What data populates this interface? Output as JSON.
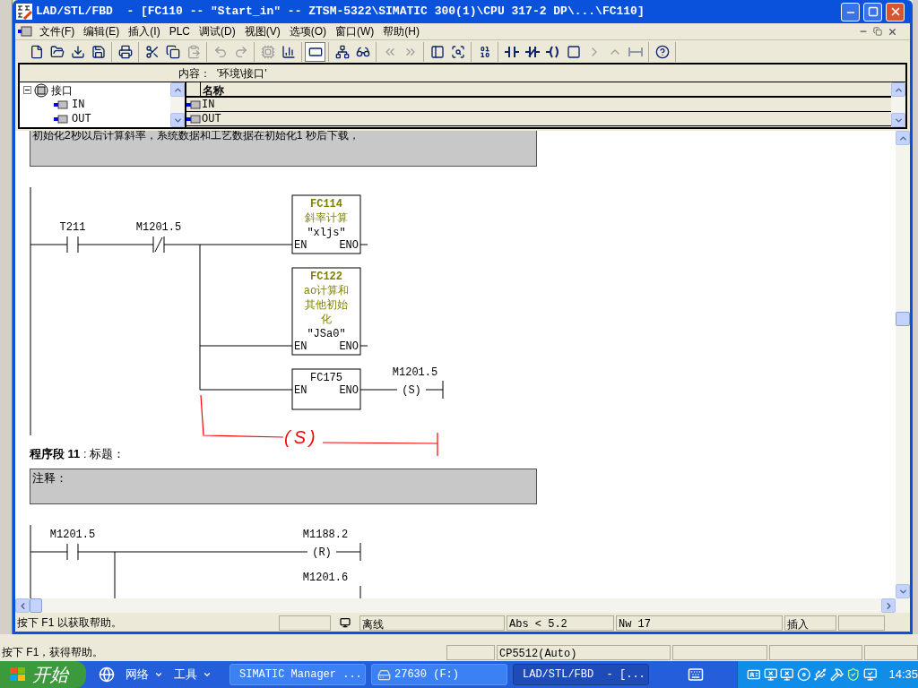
{
  "window": {
    "title": "LAD/STL/FBD  - [FC110 -- ″Start_in″ -- ZTSM-5322\\SIMATIC 300(1)\\CPU 317-2 DP\\...\\FC110]"
  },
  "menu": [
    "文件(F)",
    "编辑(E)",
    "插入(I)",
    "PLC",
    "调试(D)",
    "视图(V)",
    "选项(O)",
    "窗口(W)",
    "帮助(H)"
  ],
  "toolbar": [
    [
      {
        "kind": "new",
        "disabled": false,
        "pressed": false
      },
      {
        "kind": "open",
        "disabled": false,
        "pressed": false
      },
      {
        "kind": "download",
        "disabled": false,
        "pressed": false
      },
      {
        "kind": "save",
        "disabled": false,
        "pressed": false
      }
    ],
    [
      {
        "kind": "print",
        "disabled": false,
        "pressed": false
      }
    ],
    [
      {
        "kind": "cut",
        "disabled": false,
        "pressed": false
      },
      {
        "kind": "copy",
        "disabled": false,
        "pressed": false
      },
      {
        "kind": "paste",
        "disabled": true,
        "pressed": false
      }
    ],
    [
      {
        "kind": "undo",
        "disabled": true,
        "pressed": false
      },
      {
        "kind": "redo",
        "disabled": true,
        "pressed": false
      }
    ],
    [
      {
        "kind": "compile",
        "disabled": true,
        "pressed": false
      },
      {
        "kind": "monitor",
        "disabled": false,
        "pressed": false
      }
    ],
    [
      {
        "kind": "overview",
        "disabled": false,
        "pressed": true
      }
    ],
    [
      {
        "kind": "network",
        "disabled": false,
        "pressed": false
      },
      {
        "kind": "glasses",
        "disabled": false,
        "pressed": false
      }
    ],
    [
      {
        "kind": "prev",
        "disabled": true,
        "pressed": false
      },
      {
        "kind": "next",
        "disabled": true,
        "pressed": false
      }
    ],
    [
      {
        "kind": "details",
        "disabled": false,
        "pressed": false
      },
      {
        "kind": "zoom",
        "disabled": false,
        "pressed": false
      }
    ],
    [
      {
        "kind": "bits",
        "disabled": false,
        "pressed": false
      }
    ],
    [
      {
        "kind": "contact",
        "disabled": false,
        "pressed": false
      },
      {
        "kind": "nc-contact",
        "disabled": false,
        "pressed": false
      },
      {
        "kind": "coil",
        "disabled": false,
        "pressed": false
      },
      {
        "kind": "empty-box",
        "disabled": false,
        "pressed": false
      },
      {
        "kind": "open-branch",
        "disabled": true,
        "pressed": false
      },
      {
        "kind": "close-branch",
        "disabled": true,
        "pressed": false
      },
      {
        "kind": "jump",
        "disabled": true,
        "pressed": false
      }
    ],
    [
      {
        "kind": "help",
        "disabled": false,
        "pressed": false
      }
    ]
  ],
  "interface": {
    "path": "内容：  '环境\\接口'",
    "tree": {
      "label": "接口",
      "expanded": true,
      "children": [
        {
          "label": "IN"
        },
        {
          "label": "OUT"
        }
      ]
    },
    "column": "名称",
    "rows": [
      "IN",
      "OUT"
    ]
  },
  "networks": [
    {
      "comment": "初始化2秒以后计算斜率，系统数据和工艺数据在初始化1 秒后下载，",
      "contacts": [
        {
          "operand": "T211",
          "kind": "no"
        },
        {
          "operand": "M1201.5",
          "kind": "nc"
        }
      ],
      "blocks": [
        {
          "name": "FC114",
          "comment": [
            "斜率计算"
          ],
          "symbol": "″xljs″",
          "pins": [
            "EN",
            "ENO"
          ]
        },
        {
          "name": "FC122",
          "comment": [
            "ao计算和",
            "其他初始",
            "化"
          ],
          "symbol": "″JSa0″",
          "pins": [
            "EN",
            "ENO"
          ]
        },
        {
          "name": "FC175",
          "pins": [
            "EN",
            "ENO"
          ],
          "coil": {
            "operand": "M1201.5",
            "symbol": "(S)"
          }
        }
      ],
      "annotation": "(S)"
    },
    {
      "title": "**程序段  11** : 标题：",
      "comment": "注释：",
      "contacts": [
        {
          "operand": "M1201.5",
          "kind": "no"
        }
      ],
      "coils": [
        {
          "operand": "M1188.2",
          "symbol": "(R)"
        },
        {
          "operand": "M1201.6"
        }
      ]
    }
  ],
  "status_bar": {
    "hint": "按下 F1 以获取帮助。",
    "mode": "离线",
    "address": "Abs < 5.2",
    "network": "Nw 17",
    "input": "插入"
  },
  "manager_status": {
    "hint": "按下 F1，获得帮助。",
    "interface": "CP5512(Auto)"
  },
  "taskbar": {
    "start": "开始",
    "toolbars": [
      "网络",
      "工具"
    ],
    "tasks": [
      {
        "label": "SIMATIC Manager ...",
        "selected": false
      },
      {
        "label": "27630 (F:)",
        "selected": false
      },
      {
        "label": "LAD/STL/FBD  - [...",
        "selected": true
      }
    ],
    "clock": "14:35"
  }
}
